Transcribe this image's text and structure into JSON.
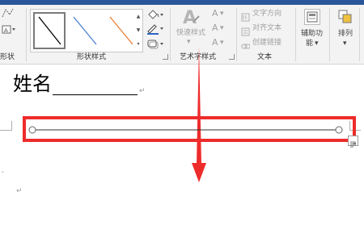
{
  "ribbon": {
    "insert_shapes_group_label": "形状",
    "shape_styles": {
      "group_label": "形状样式",
      "gallery_colors": [
        "#000000",
        "#4a7fd0",
        "#ed7d31"
      ],
      "scroll_up": "▲",
      "scroll_down": "▼",
      "scroll_more": "▾"
    },
    "shape_format": {
      "fill_icon": "fill-bucket-icon",
      "outline_icon": "pen-outline-icon",
      "effects_icon": "shape-effects-icon"
    },
    "wordart_styles": {
      "group_label": "艺术字样式",
      "quick_styles_label": "快速样式",
      "text_fill": "A",
      "text_outline": "A",
      "text_effects": "A"
    },
    "text": {
      "group_label": "文本",
      "text_direction": "文字方向",
      "align_text": "对齐文本",
      "create_link": "创建链接"
    },
    "accessibility": {
      "label_line1": "辅助功",
      "label_line2": "能"
    },
    "arrange": {
      "label": "排列"
    }
  },
  "document": {
    "name_label": "姓名",
    "paragraph_mark": "↵",
    "line_shape_color": "#333333",
    "highlight_color": "#ee2b2b",
    "arrow_color": "#ee2b2b"
  }
}
